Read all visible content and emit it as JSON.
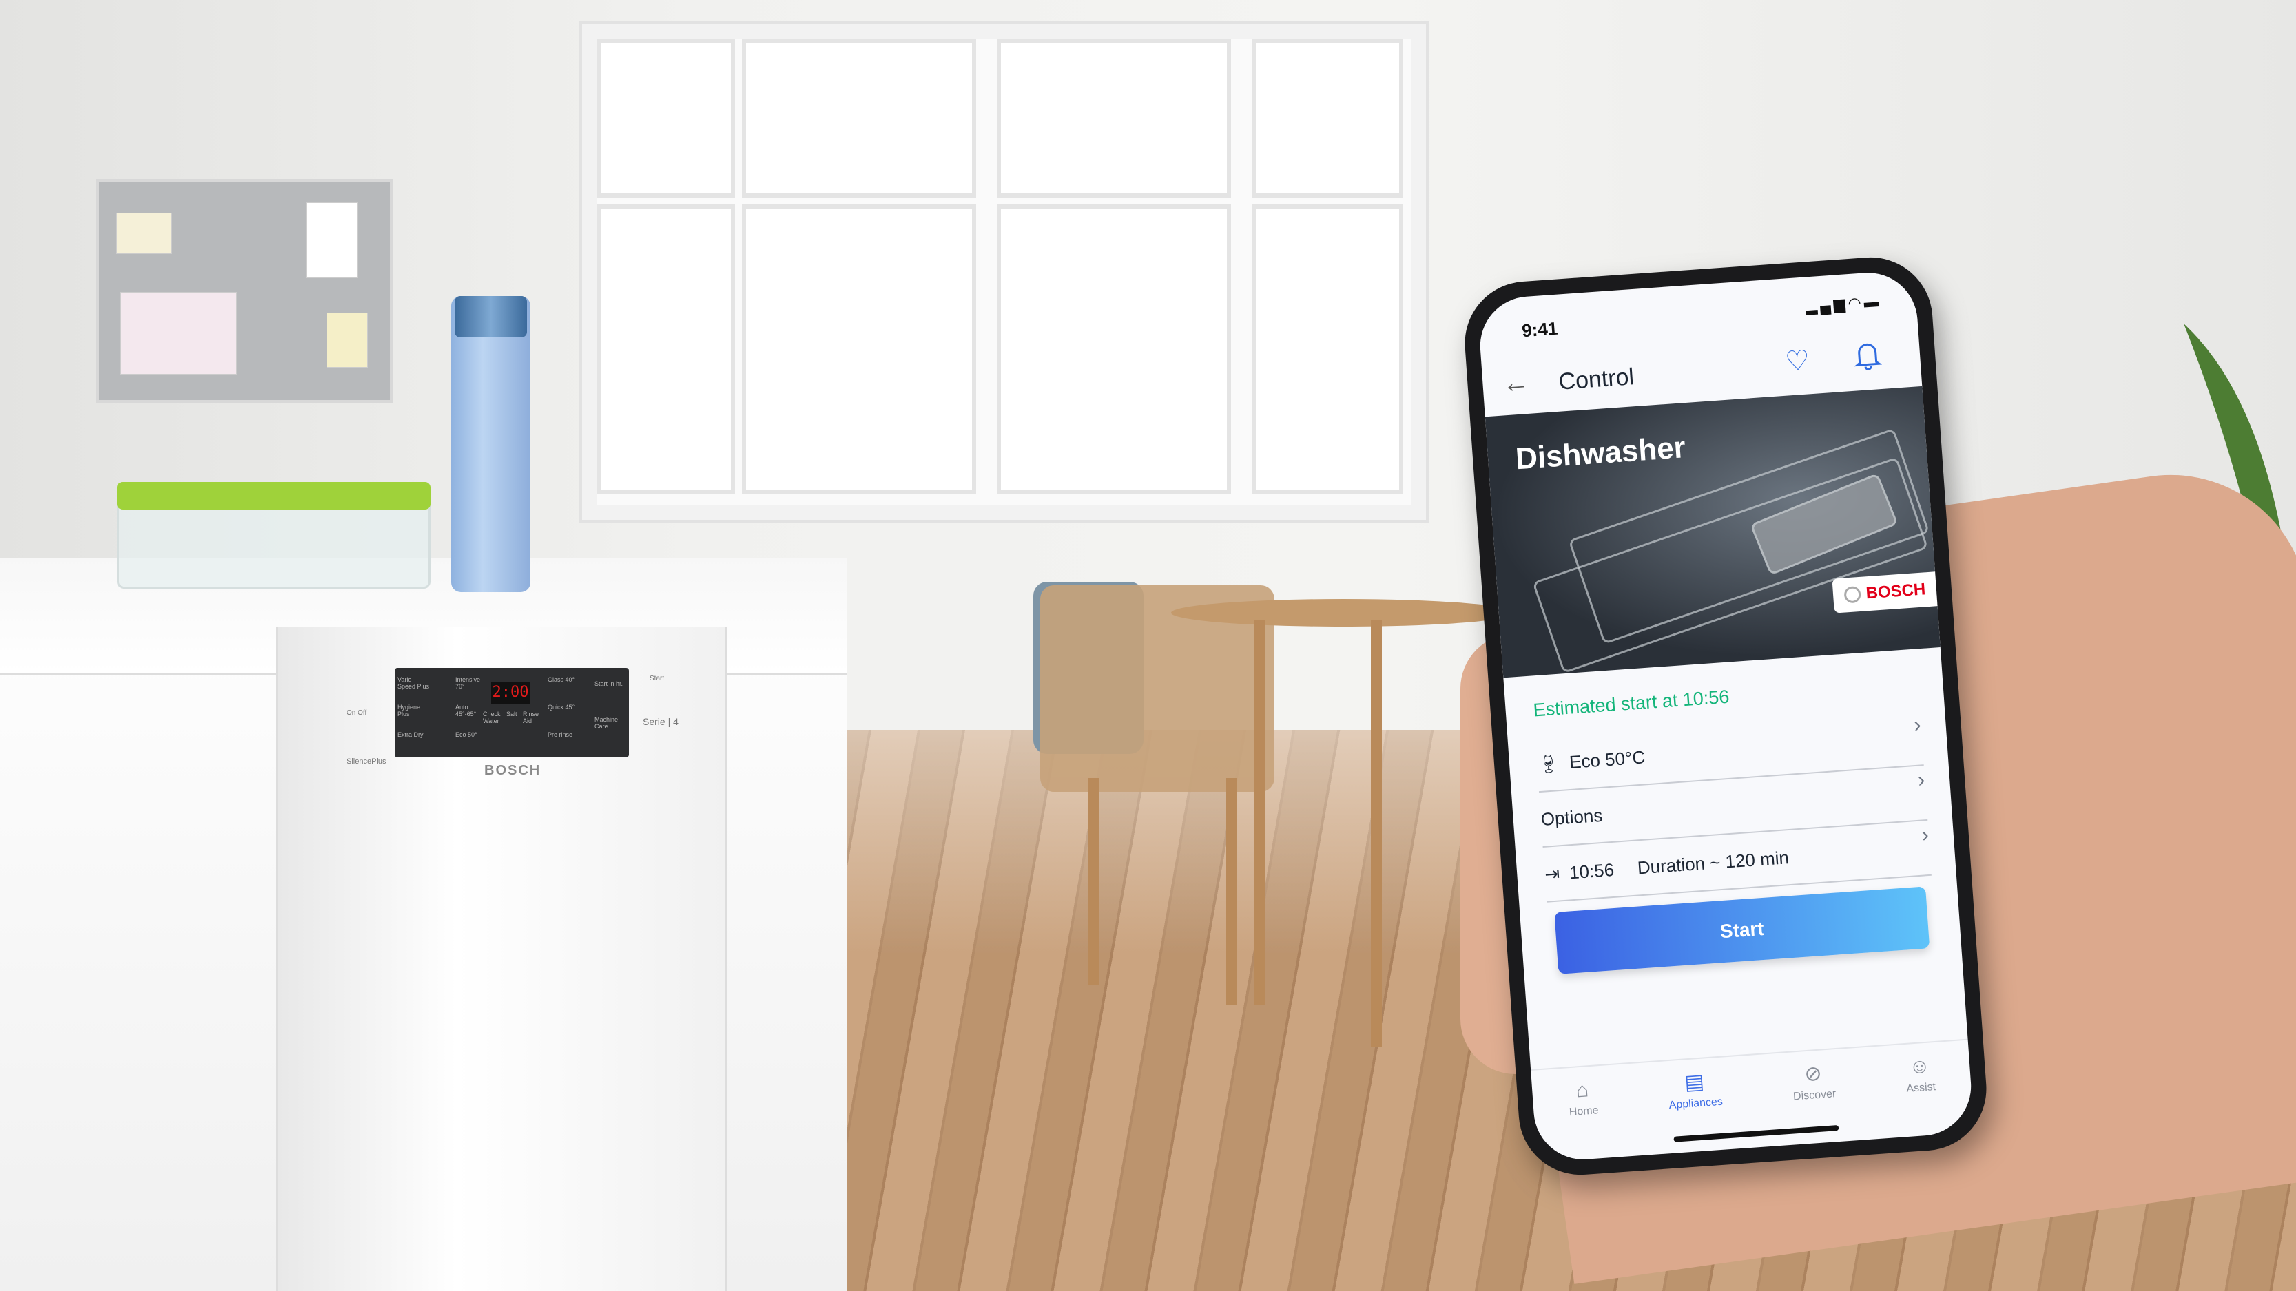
{
  "scene": {
    "dishwasher": {
      "brand": "BOSCH",
      "display": "2:00",
      "series": "Serie | 4",
      "model_line": "SilencePlus",
      "power_label": "On Off",
      "start_label": "Start",
      "panel_labels": [
        "Vario Speed Plus",
        "Hygiene Plus",
        "Extra Dry",
        "Intensive 70°",
        "Auto 45°-65°",
        "Eco 50°",
        "Check Water",
        "Salt",
        "Rinse Aid",
        "Glass 40°",
        "Quick 45°",
        "Pre rinse",
        "Start in hr.",
        "Machine Care"
      ]
    }
  },
  "phone": {
    "status_bar": {
      "time": "9:41",
      "icons": [
        "signal-icon",
        "wifi-icon",
        "battery-icon"
      ]
    },
    "header": {
      "title": "Control",
      "back_icon": "arrow-left-icon",
      "favorite_icon": "heart-icon",
      "notifications_icon": "bell-icon"
    },
    "hero": {
      "title": "Dishwasher",
      "brand": "BOSCH"
    },
    "estimated_start": "Estimated start at 10:56",
    "rows": [
      {
        "icon": "glass-cup-icon",
        "label": "Eco 50°C"
      },
      {
        "label": "Options"
      },
      {
        "icon": "start-time-icon",
        "time": "10:56",
        "label": "Duration ~ 120 min"
      }
    ],
    "start_button": "Start",
    "nav": [
      {
        "label": "Home",
        "icon": "home-icon",
        "active": false
      },
      {
        "label": "Appliances",
        "icon": "appliances-icon",
        "active": true
      },
      {
        "label": "Discover",
        "icon": "compass-icon",
        "active": false
      },
      {
        "label": "Assist",
        "icon": "chat-smile-icon",
        "active": false
      }
    ],
    "colors": {
      "accent": "#3f6ee6",
      "success": "#14b57a",
      "button_start": "#3b61e3",
      "button_end": "#5ec3f9",
      "brand_red": "#e2001a"
    }
  }
}
